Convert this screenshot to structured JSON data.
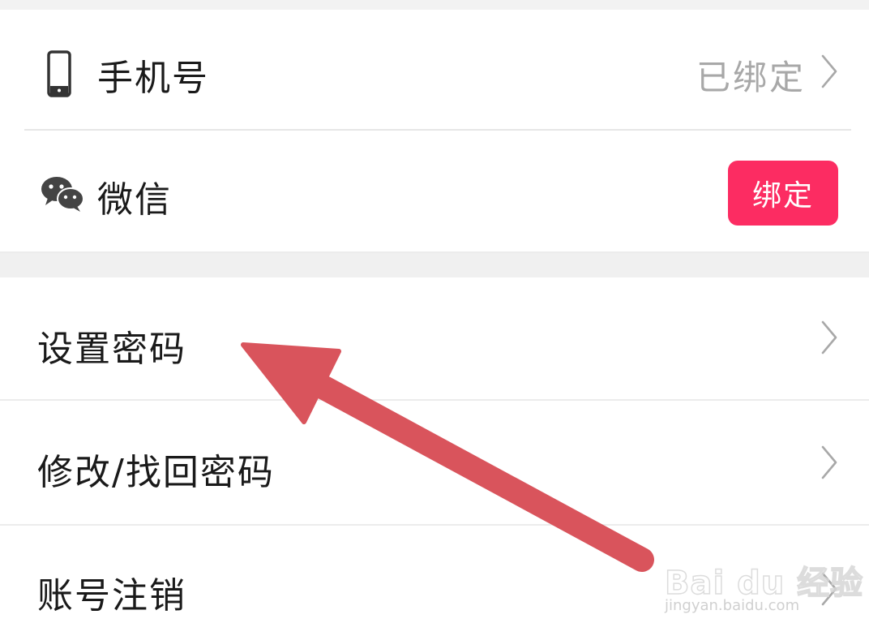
{
  "account_bindings": {
    "phone": {
      "label": "手机号",
      "status": "已绑定",
      "icon": "phone-icon"
    },
    "wechat": {
      "label": "微信",
      "button_label": "绑定",
      "icon": "wechat-icon"
    }
  },
  "security": {
    "set_password": {
      "label": "设置密码"
    },
    "modify_password": {
      "label": "修改/找回密码"
    },
    "account_cancel": {
      "label": "账号注销"
    }
  },
  "colors": {
    "accent": "#fc2c62",
    "arrow": "#d9545c",
    "status_text": "#a8a8a8",
    "divider": "#e6e6e6"
  },
  "watermark": {
    "logo_text": "Bai du 经验",
    "url": "jingyan.baidu.com"
  }
}
